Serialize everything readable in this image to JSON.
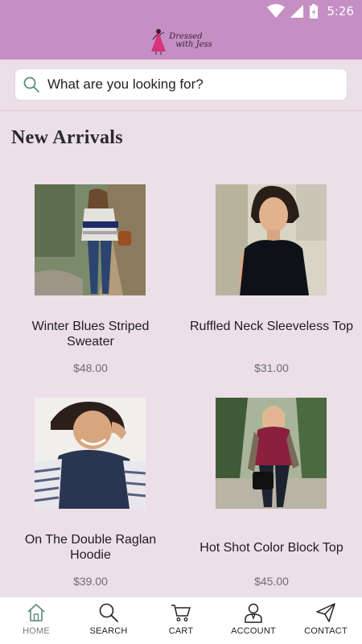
{
  "status_bar": {
    "time": "5:26"
  },
  "app": {
    "logo_line1": "Dressed",
    "logo_line2": "with Jess"
  },
  "search": {
    "placeholder": "What are you looking for?"
  },
  "section": {
    "title": "New Arrivals"
  },
  "products": [
    {
      "name": "Winter Blues Striped Sweater",
      "price": "$48.00"
    },
    {
      "name": "Ruffled Neck Sleeveless Top",
      "price": "$31.00"
    },
    {
      "name": "On The Double Raglan Hoodie",
      "price": "$39.00"
    },
    {
      "name": "Hot Shot Color Block Top",
      "price": "$45.00"
    }
  ],
  "bottom_nav": {
    "items": [
      {
        "label": "HOME",
        "icon": "home-icon"
      },
      {
        "label": "SEARCH",
        "icon": "search-icon"
      },
      {
        "label": "CART",
        "icon": "cart-icon"
      },
      {
        "label": "ACCOUNT",
        "icon": "account-icon"
      },
      {
        "label": "CONTACT",
        "icon": "send-icon"
      }
    ]
  },
  "colors": {
    "brand": "#c48fc3",
    "background": "#ecdfe8",
    "active_nav": "#5f8a7e"
  }
}
